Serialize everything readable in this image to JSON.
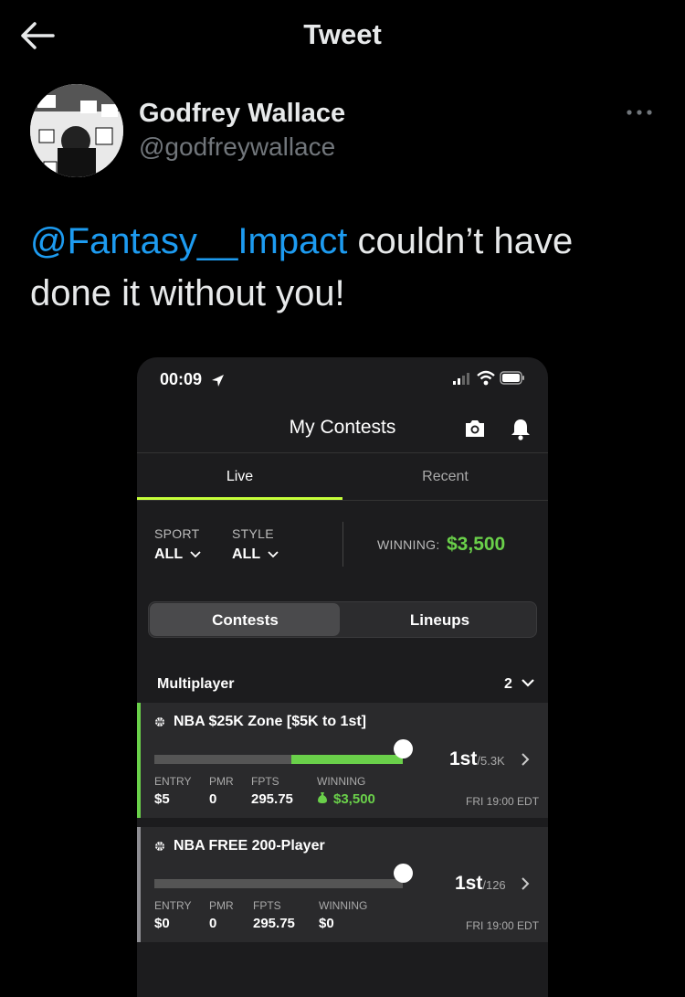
{
  "header": {
    "title": "Tweet"
  },
  "author": {
    "name": "Godfrey Wallace",
    "handle": "@godfreywallace"
  },
  "tweet": {
    "mention": "@Fantasy__Impact",
    "text": " couldn’t have done it without you!"
  },
  "app": {
    "status_time": "00:09",
    "title": "My Contests",
    "tabs": [
      {
        "label": "Live"
      },
      {
        "label": "Recent"
      }
    ],
    "filters": {
      "sport_label": "SPORT",
      "sport_value": "ALL",
      "style_label": "STYLE",
      "style_value": "ALL",
      "winning_label": "WINNING:",
      "winning_value": "$3,500"
    },
    "segments": [
      {
        "label": "Contests"
      },
      {
        "label": "Lineups"
      }
    ],
    "section": {
      "title": "Multiplayer",
      "count": "2"
    },
    "contests": [
      {
        "name": "NBA $25K Zone [$5K to 1st]",
        "progress": 0.45,
        "rank": "1st",
        "rank_total": "/5.3K",
        "entry_label": "ENTRY",
        "entry": "$5",
        "pmr_label": "PMR",
        "pmr": "0",
        "fpts_label": "FPTS",
        "fpts": "295.75",
        "winning_label": "WINNING",
        "winning": "$3,500",
        "date": "FRI 19:00 EDT",
        "accent": "#6ad04a"
      },
      {
        "name": "NBA FREE 200-Player",
        "progress": 0,
        "rank": "1st",
        "rank_total": "/126",
        "entry_label": "ENTRY",
        "entry": "$0",
        "pmr_label": "PMR",
        "pmr": "0",
        "fpts_label": "FPTS",
        "fpts": "295.75",
        "winning_label": "WINNING",
        "winning": "$0",
        "date": "FRI 19:00 EDT",
        "accent": "#8e8e93"
      }
    ]
  }
}
